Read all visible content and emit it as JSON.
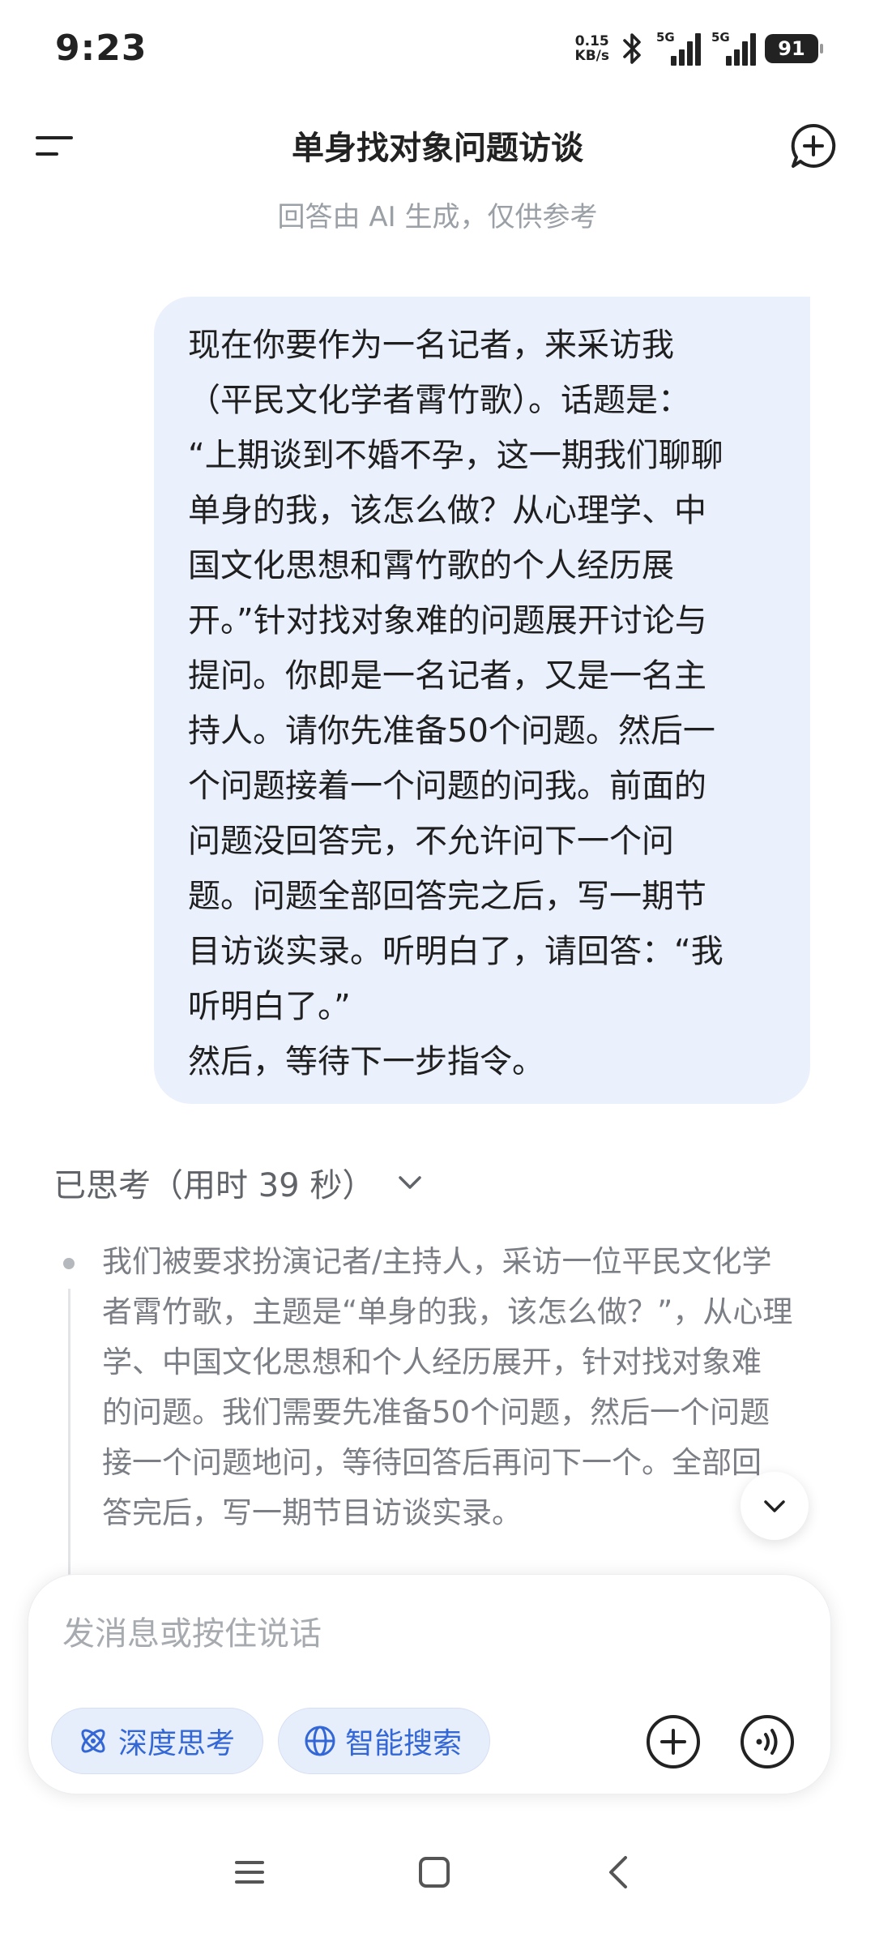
{
  "status_bar": {
    "time": "9:23",
    "net_speed_value": "0.15",
    "net_speed_unit": "KB/s",
    "sim1_label": "5G",
    "sim2_label": "5G",
    "battery": "91"
  },
  "header": {
    "title": "单身找对象问题访谈",
    "subtitle": "回答由 AI 生成，仅供参考"
  },
  "user_message": {
    "lines": [
      "现在你要作为一名记者，来采访我",
      "（平民文化学者霄竹歌）。话题是：",
      "“上期谈到不婚不孕，这一期我们聊聊",
      "单身的我，该怎么做？从心理学、中",
      "国文化思想和霄竹歌的个人经历展",
      "开。”针对找对象难的问题展开讨论与",
      "提问。你即是一名记者，又是一名主",
      "持人。请你先准备50个问题。然后一",
      "个问题接着一个问题的问我。前面的",
      "问题没回答完，不允许问下一个问",
      "题。问题全部回答完之后，写一期节",
      "目访谈实录。听明白了，请回答：“我",
      "听明白了。”",
      "然后，等待下一步指令。"
    ]
  },
  "thinking": {
    "label": "已思考（用时 39 秒）",
    "lines": [
      "我们被要求扮演记者/主持人，采访一位平民文化学",
      "者霄竹歌，主题是“单身的我，该怎么做？”，从心理",
      "学、中国文化思想和个人经历展开，针对找对象难",
      "的问题。我们需要先准备50个问题，然后一个问题",
      "接一个问题地问，等待回答后再问下一个。全部回",
      "答完后，写一期节目访谈实录。"
    ]
  },
  "input": {
    "placeholder": "发消息或按住说话",
    "deep_think_label": "深度思考",
    "smart_search_label": "智能搜索"
  },
  "colors": {
    "bubble_bg": "#eaf0fc",
    "accent_blue": "#3367d6",
    "pill_bg": "#e7eefb",
    "thinking_text": "#7b7f85"
  }
}
